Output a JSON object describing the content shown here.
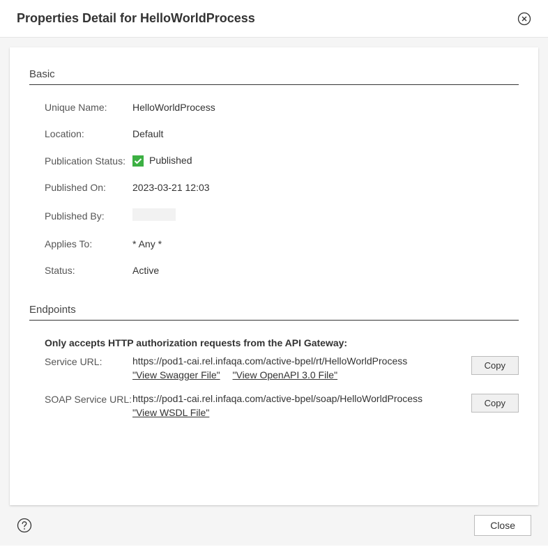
{
  "header": {
    "title": "Properties Detail for HelloWorldProcess"
  },
  "sections": {
    "basic": {
      "title": "Basic",
      "fields": {
        "unique_name": {
          "label": "Unique Name:",
          "value": "HelloWorldProcess"
        },
        "location": {
          "label": "Location:",
          "value": "Default"
        },
        "publication_status": {
          "label": "Publication Status:",
          "value": "Published"
        },
        "published_on": {
          "label": "Published On:",
          "value": "2023-03-21 12:03"
        },
        "published_by": {
          "label": "Published By:",
          "value": ""
        },
        "applies_to": {
          "label": "Applies To:",
          "value": "* Any *"
        },
        "status": {
          "label": "Status:",
          "value": "Active"
        }
      }
    },
    "endpoints": {
      "title": "Endpoints",
      "note": "Only accepts HTTP authorization requests from the API Gateway:",
      "service_url": {
        "label": "Service URL:",
        "url": "https://pod1-cai.rel.infaqa.com/active-bpel/rt/HelloWorldProcess",
        "link1": "\"View Swagger File\"",
        "link2": "\"View OpenAPI 3.0 File\"",
        "copy": "Copy"
      },
      "soap_url": {
        "label": "SOAP Service URL:",
        "url": "https://pod1-cai.rel.infaqa.com/active-bpel/soap/HelloWorldProcess",
        "link1": "\"View WSDL File\"",
        "copy": "Copy"
      }
    }
  },
  "footer": {
    "close": "Close"
  }
}
